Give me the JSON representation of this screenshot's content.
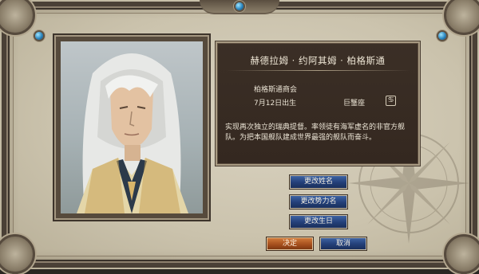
{
  "character": {
    "name": "赫德拉姆 · 约阿其姆 · 柏格斯通",
    "faction": "柏格斯通商会",
    "birthday": "7月12日出生",
    "zodiac": "巨蟹座",
    "zodiac_symbol": "♋",
    "bio": "实现再次独立的瑞典提督。率领徒有海军虚名的非官方舰队。为把本国舰队建成世界最强的舰队而奋斗。"
  },
  "buttons": {
    "rename": "更改姓名",
    "change_faction": "更改势力名",
    "change_birthday": "更改生日",
    "confirm": "决定",
    "cancel": "取消"
  },
  "colors": {
    "background": "#cbc3ad",
    "panel": "#3b2f26",
    "button_blue": "#233f78",
    "button_orange": "#a34d1c",
    "gem": "#2a86c0"
  },
  "icons": [
    "gem-icon",
    "compass-rose-icon",
    "zodiac-cancer-icon"
  ]
}
